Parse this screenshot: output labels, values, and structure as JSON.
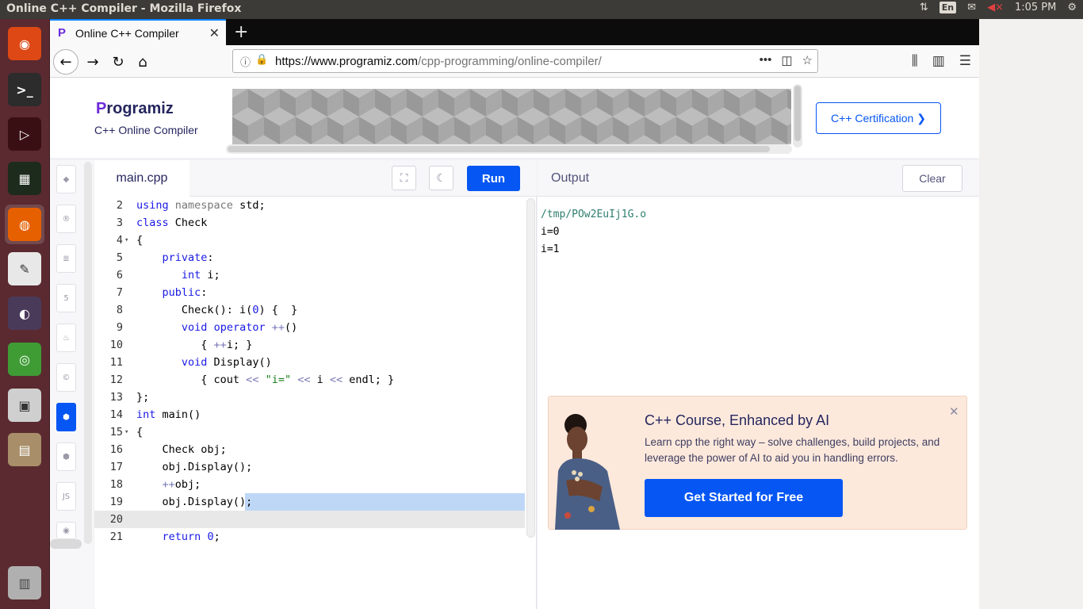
{
  "system": {
    "window_title": "Online C++ Compiler - Mozilla Firefox",
    "keyboard_layout": "En",
    "clock": "1:05 PM"
  },
  "launcher": {
    "items": [
      {
        "name": "ubuntu-dash-icon",
        "color": "#dd4814",
        "glyph": "◉"
      },
      {
        "name": "terminal-icon",
        "color": "#2c2c2c",
        "glyph": ">_"
      },
      {
        "name": "logic-gate-icon",
        "color": "#3a0f14",
        "glyph": "▷"
      },
      {
        "name": "system-monitor-icon",
        "color": "#1d2b1d",
        "glyph": "▦"
      },
      {
        "name": "firefox-icon",
        "color": "#e66000",
        "glyph": "◍"
      },
      {
        "name": "text-editor-icon",
        "color": "#e8e8e8",
        "glyph": "✎"
      },
      {
        "name": "pidgin-icon",
        "color": "#4a3a5a",
        "glyph": "◐"
      },
      {
        "name": "chrome-icon",
        "color": "#3f9c35",
        "glyph": "◎"
      },
      {
        "name": "camera-icon",
        "color": "#cfcfcf",
        "glyph": "▣"
      },
      {
        "name": "files-icon",
        "color": "#a88f6a",
        "glyph": "▤"
      }
    ],
    "trash": {
      "name": "trash-icon",
      "color": "#b0b0b0",
      "glyph": "▥"
    }
  },
  "browser": {
    "tab_title": "Online C++ Compiler",
    "url_domain": "https://www.programiz.com",
    "url_path": "/cpp-programming/online-compiler/"
  },
  "page": {
    "logo_text": "rogramiz",
    "logo_p": "P",
    "subtitle": "C++ Online Compiler",
    "cert_button": "C++ Certification ❯",
    "file_tab": "main.cpp",
    "run_label": "Run",
    "output_title": "Output",
    "clear_label": "Clear",
    "output_lines": [
      "/tmp/POw2EuIj1G.o",
      "i=0",
      "i=1"
    ],
    "promo": {
      "title": "C++ Course, Enhanced by AI",
      "desc": "Learn cpp the right way – solve challenges, build projects, and leverage the power of AI to aid you in handling errors.",
      "cta": "Get Started for Free"
    }
  },
  "code": [
    {
      "n": "2",
      "fold": "",
      "html": "<span class=\"kw\">using</span> <span class=\"gray\">namespace</span> std;"
    },
    {
      "n": "3",
      "fold": "",
      "html": "<span class=\"kw\">class</span> Check"
    },
    {
      "n": "4",
      "fold": "▾",
      "html": "{"
    },
    {
      "n": "5",
      "fold": "",
      "html": "    <span class=\"kw\">private</span>:"
    },
    {
      "n": "6",
      "fold": "",
      "html": "       <span class=\"kw\">int</span> i;"
    },
    {
      "n": "7",
      "fold": "",
      "html": "    <span class=\"kw\">public</span>:"
    },
    {
      "n": "8",
      "fold": "",
      "html": "       Check(): i(<span class=\"num\">0</span>) {  }"
    },
    {
      "n": "9",
      "fold": "",
      "html": "       <span class=\"kw\">void</span> <span class=\"kw\">operator</span> <span class=\"op\">++</span>()"
    },
    {
      "n": "10",
      "fold": "",
      "html": "          { <span class=\"op\">++</span>i; }"
    },
    {
      "n": "11",
      "fold": "",
      "html": "       <span class=\"kw\">void</span> Display()"
    },
    {
      "n": "12",
      "fold": "",
      "html": "          { cout <span class=\"op\">&lt;&lt;</span> <span class=\"str\">\"i=\"</span> <span class=\"op\">&lt;&lt;</span> i <span class=\"op\">&lt;&lt;</span> endl; }"
    },
    {
      "n": "13",
      "fold": "",
      "html": "};"
    },
    {
      "n": "14",
      "fold": "",
      "html": "<span class=\"kw\">int</span> main()"
    },
    {
      "n": "15",
      "fold": "▾",
      "html": "{"
    },
    {
      "n": "16",
      "fold": "",
      "html": "    Check obj;"
    },
    {
      "n": "17",
      "fold": "",
      "html": "    obj.Display();"
    },
    {
      "n": "18",
      "fold": "",
      "html": "    <span class=\"op\">++</span>obj;"
    },
    {
      "n": "19",
      "fold": "",
      "html": "    obj.Display();"
    },
    {
      "n": "20",
      "fold": "",
      "html": ""
    },
    {
      "n": "21",
      "fold": "",
      "html": "    <span class=\"kw\">return</span> <span class=\"num\">0</span>;"
    }
  ]
}
